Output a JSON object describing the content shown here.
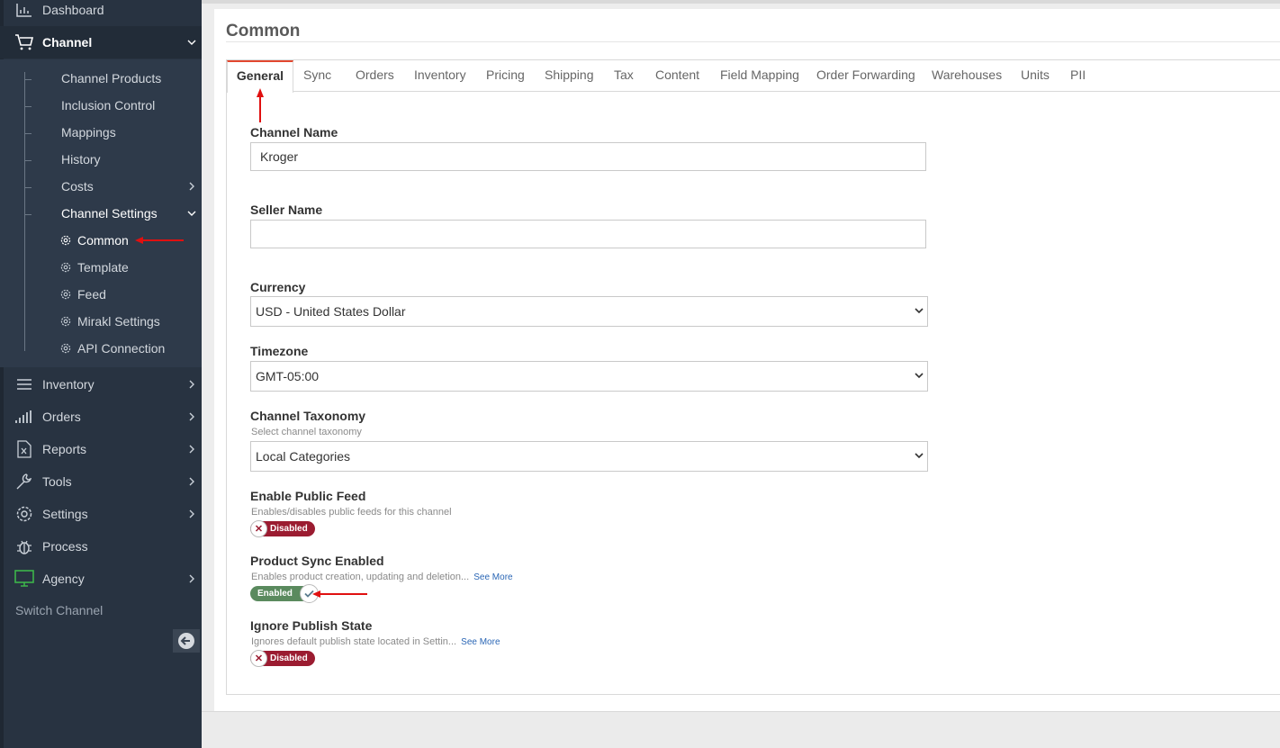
{
  "sidebar": {
    "top_items": [
      {
        "label": "Dashboard",
        "icon": "bar-chart-icon"
      },
      {
        "label": "Channel",
        "icon": "cart-icon"
      }
    ],
    "channel_sub": [
      {
        "label": "Channel Products"
      },
      {
        "label": "Inclusion Control"
      },
      {
        "label": "Mappings"
      },
      {
        "label": "History"
      },
      {
        "label": "Costs"
      },
      {
        "label": "Channel Settings"
      }
    ],
    "settings_sub": [
      {
        "label": "Common"
      },
      {
        "label": "Template"
      },
      {
        "label": "Feed"
      },
      {
        "label": "Mirakl Settings"
      },
      {
        "label": "API Connection"
      }
    ],
    "bottom_items": [
      {
        "label": "Inventory",
        "icon": "list-icon"
      },
      {
        "label": "Orders",
        "icon": "signal-icon"
      },
      {
        "label": "Reports",
        "icon": "excel-file-icon"
      },
      {
        "label": "Tools",
        "icon": "wrench-icon"
      },
      {
        "label": "Settings",
        "icon": "gear-icon"
      },
      {
        "label": "Process",
        "icon": "bug-icon"
      },
      {
        "label": "Agency",
        "icon": "monitor-icon"
      }
    ],
    "switch_channel": "Switch Channel"
  },
  "page": {
    "title": "Common",
    "tabs": [
      "General",
      "Sync",
      "Orders",
      "Inventory",
      "Pricing",
      "Shipping",
      "Tax",
      "Content",
      "Field Mapping",
      "Order Forwarding",
      "Warehouses",
      "Units",
      "PII"
    ],
    "active_tab": "General"
  },
  "form": {
    "channel_name": {
      "label": "Channel Name",
      "value": "Kroger"
    },
    "seller_name": {
      "label": "Seller Name",
      "value": ""
    },
    "currency": {
      "label": "Currency",
      "value": "USD - United States Dollar"
    },
    "timezone": {
      "label": "Timezone",
      "value": "GMT-05:00"
    },
    "taxonomy": {
      "label": "Channel Taxonomy",
      "help": "Select channel taxonomy",
      "value": "Local Categories"
    },
    "public_feed": {
      "label": "Enable Public Feed",
      "help": "Enables/disables public feeds for this channel",
      "state": "Disabled"
    },
    "product_sync": {
      "label": "Product Sync Enabled",
      "help": "Enables product creation, updating and deletion...",
      "see_more": "See More",
      "state": "Enabled"
    },
    "ignore_publish": {
      "label": "Ignore Publish State",
      "help": "Ignores default publish state located in Settin...",
      "see_more": "See More",
      "state": "Disabled"
    }
  },
  "colors": {
    "sidebar_bg": "#283341",
    "accent_tab": "#e2482f",
    "annotation_arrow": "#e01010",
    "toggle_off": "#9b1c31",
    "toggle_on": "#5a8a5e",
    "agency_icon": "#3db54a"
  }
}
